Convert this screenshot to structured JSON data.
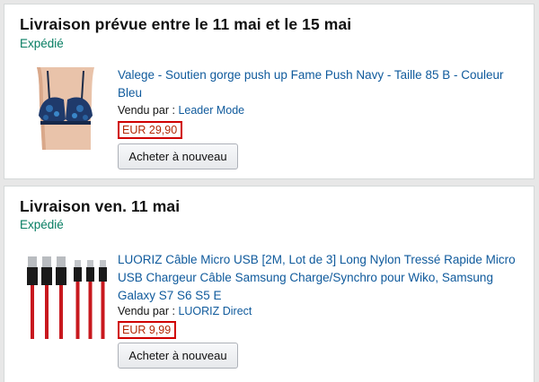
{
  "orders": [
    {
      "delivery_title": "Livraison prévue entre le 11 mai et le 15 mai",
      "status": "Expédié",
      "product_title": "Valege - Soutien gorge push up Fame Push Navy - Taille 85 B - Couleur Bleu",
      "seller_label": "Vendu par :",
      "seller_name": "Leader Mode",
      "price": "EUR 29,90",
      "button_label": "Acheter à nouveau",
      "image_icon": "bra-product-image"
    },
    {
      "delivery_title": "Livraison ven. 11 mai",
      "status": "Expédié",
      "product_title": "LUORIZ Câble Micro USB [2M, Lot de 3] Long Nylon Tressé Rapide Micro USB Chargeur Câble Samsung Charge/Synchro pour Wiko, Samsung Galaxy S7 S6 S5 E",
      "seller_label": "Vendu par :",
      "seller_name": "LUORIZ Direct",
      "price": "EUR 9,99",
      "button_label": "Acheter à nouveau",
      "image_icon": "usb-cable-product-image"
    }
  ],
  "colors": {
    "link": "#0f5a9c",
    "status_green": "#067d62",
    "price": "#b12704",
    "highlight_box": "#d00000"
  }
}
